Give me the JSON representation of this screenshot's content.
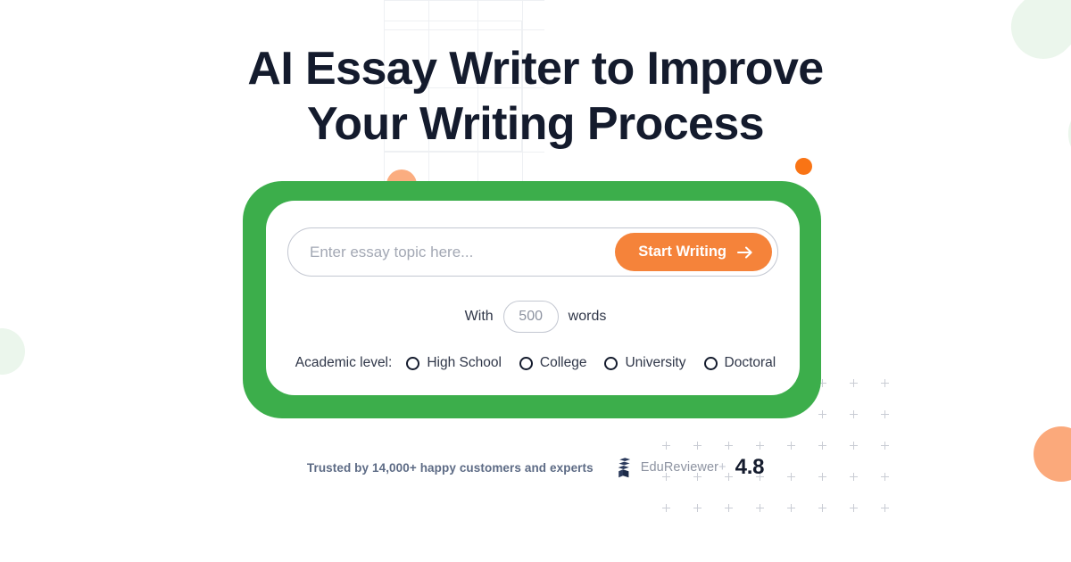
{
  "headline": {
    "line1": "AI Essay Writer to Improve",
    "line2": "Your Writing Process"
  },
  "form": {
    "topic_placeholder": "Enter essay topic here...",
    "topic_value": "",
    "start_button_label": "Start Writing",
    "start_button_icon": "arrow-right-icon",
    "words_prefix": "With",
    "words_value": "500",
    "words_suffix": "words",
    "level_label": "Academic level:",
    "levels": [
      {
        "label": "High School",
        "selected": false
      },
      {
        "label": "College",
        "selected": false
      },
      {
        "label": "University",
        "selected": false
      },
      {
        "label": "Doctoral",
        "selected": false
      }
    ]
  },
  "trust": {
    "text": "Trusted by 14,000+ happy customers and experts",
    "logo_icon": "edureviewer-book-logo",
    "brand": "EduReviewer",
    "brand_plus": "+",
    "rating": "4.8"
  },
  "colors": {
    "card_green": "#3cae4b",
    "accent_orange": "#f5833a",
    "dot_orange": "#f97415",
    "peach": "#fbad80",
    "pale_green": "#ebf6ec",
    "heading": "#141b2d",
    "trust_text": "#5d6b85"
  }
}
